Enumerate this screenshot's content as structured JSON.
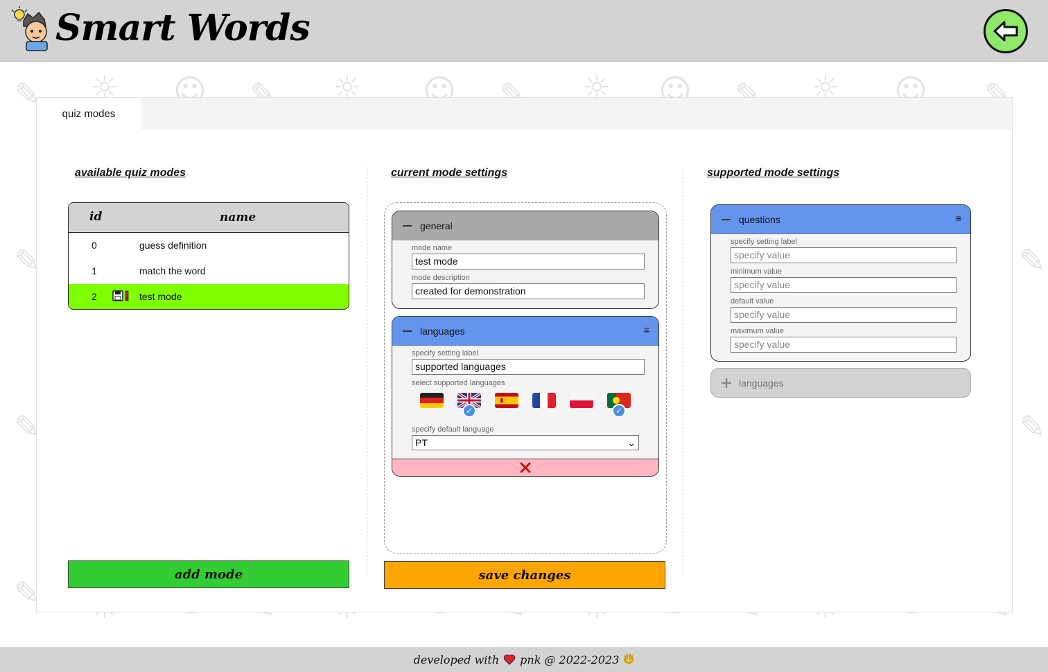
{
  "app": {
    "title": "Smart Words"
  },
  "header": {
    "logo_icon": "student-lightbulb-icon",
    "back_icon": "back-arrow-icon"
  },
  "tabs": [
    {
      "label": "quiz modes"
    }
  ],
  "columns": {
    "available": {
      "title": "available quiz modes"
    },
    "current": {
      "title": "current mode settings"
    },
    "supported": {
      "title": "supported mode settings"
    }
  },
  "modes_table": {
    "headers": {
      "id": "id",
      "name": "name"
    },
    "rows": [
      {
        "id": "0",
        "name": "guess definition",
        "selected": false
      },
      {
        "id": "1",
        "name": "match the word",
        "selected": false
      },
      {
        "id": "2",
        "name": "test mode",
        "selected": true,
        "icons": [
          "save-icon",
          "warning-icon"
        ]
      }
    ]
  },
  "buttons": {
    "add_mode": "add mode",
    "save_changes": "save changes"
  },
  "general_card": {
    "title": "general",
    "mode_name_label": "mode name",
    "mode_name_value": "test mode",
    "mode_description_label": "mode description",
    "mode_description_value": "created for demonstration"
  },
  "languages_card": {
    "title": "languages",
    "setting_label_label": "specify setting label",
    "setting_label_value": "supported languages",
    "select_languages_label": "select supported languages",
    "flags": [
      {
        "code": "de",
        "selected": false
      },
      {
        "code": "gb",
        "selected": true
      },
      {
        "code": "es",
        "selected": false
      },
      {
        "code": "fr",
        "selected": false
      },
      {
        "code": "pl",
        "selected": false
      },
      {
        "code": "pt",
        "selected": true
      }
    ],
    "default_language_label": "specify default language",
    "default_language_value": "PT"
  },
  "questions_card": {
    "title": "questions",
    "fields": [
      {
        "label": "specify setting label",
        "placeholder": "specify value"
      },
      {
        "label": "minimum value",
        "placeholder": "specify value"
      },
      {
        "label": "default value",
        "placeholder": "specify value"
      },
      {
        "label": "maximum value",
        "placeholder": "specify value"
      }
    ]
  },
  "add_setting": {
    "label": "languages"
  },
  "footer": {
    "prefix": "developed with",
    "author": "pnk @ 2022-2023"
  },
  "colors": {
    "header_bg": "#d3d3d3",
    "selected_row": "#80ff00",
    "add_mode_button": "#32cd32",
    "save_changes_button": "#ffa500",
    "general_header": "#a9a9a9",
    "languages_header": "#6495ed",
    "remove_bar": "#ffb6c1",
    "back_button": "#8ee86a"
  }
}
